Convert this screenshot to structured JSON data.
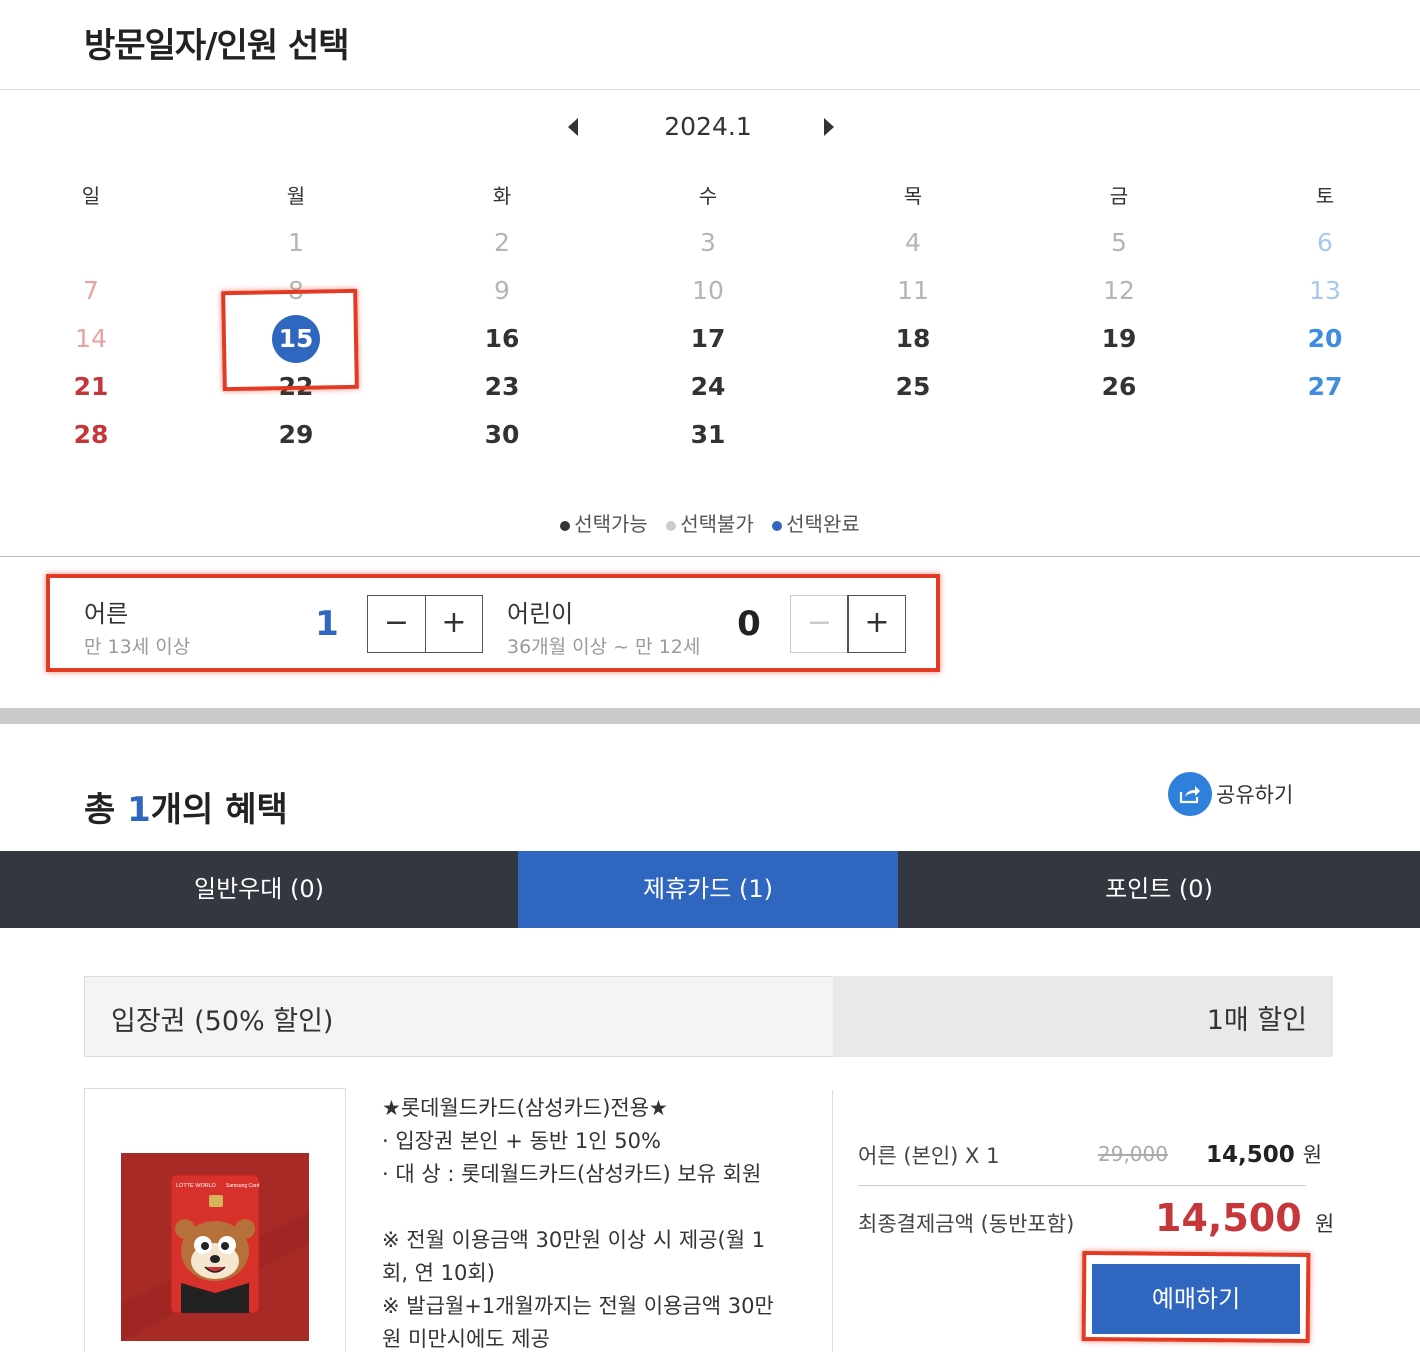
{
  "section_title": "방문일자/인원 선택",
  "calendar": {
    "month_label": "2024.1",
    "weekdays": [
      "일",
      "월",
      "화",
      "수",
      "목",
      "금",
      "토"
    ],
    "days": {
      "d1": "1",
      "d2": "2",
      "d3": "3",
      "d4": "4",
      "d5": "5",
      "d6": "6",
      "d7": "7",
      "d8": "8",
      "d9": "9",
      "d10": "10",
      "d11": "11",
      "d12": "12",
      "d13": "13",
      "d14": "14",
      "d15": "15",
      "d16": "16",
      "d17": "17",
      "d18": "18",
      "d19": "19",
      "d20": "20",
      "d21": "21",
      "d22": "22",
      "d23": "23",
      "d24": "24",
      "d25": "25",
      "d26": "26",
      "d27": "27",
      "d28": "28",
      "d29": "29",
      "d30": "30",
      "d31": "31"
    },
    "legend": {
      "available": "선택가능",
      "unavailable": "선택불가",
      "selected": "선택완료"
    }
  },
  "persons": {
    "adult": {
      "label": "어른",
      "sub": "만 13세 이상",
      "count": "1"
    },
    "child": {
      "label": "어린이",
      "sub": "36개월 이상 ~ 만 12세",
      "count": "0"
    },
    "minus": "−",
    "plus": "+"
  },
  "benefits": {
    "title_prefix": "총 ",
    "title_count": "1",
    "title_suffix": "개의 혜택",
    "share_label": "공유하기",
    "tabs": [
      "일반우대 (0)",
      "제휴카드 (1)",
      "포인트 (0)"
    ]
  },
  "coupon": {
    "name": "입장권 (50% 할인)",
    "limit": "1매 할인",
    "desc_lines": [
      "★롯데월드카드(삼성카드)전용★",
      "· 입장권 본인 + 동반 1인 50%",
      "· 대 상 : 롯데월드카드(삼성카드) 보유 회원",
      "",
      "※ 전월 이용금액 30만원 이상 시 제공(월 1",
      "회, 연 10회)",
      "※ 발급월+1개월까지는 전월 이용금액 30만",
      "원 미만시에도 제공"
    ],
    "card_brand": "LOTTE WORLD",
    "card_issuer": "Samsung Card",
    "price_label": "어른 (본인) X 1",
    "old_price": "29,000",
    "new_price": "14,500",
    "won": "원",
    "total_label": "최종결제금액 (동반포함)",
    "total_price": "14,500",
    "buy_label": "예매하기"
  },
  "colors": {
    "accent_blue": "#2f66c0",
    "sunday_red": "#c5373b",
    "saturday_blue": "#3e8de0",
    "annotation_red": "#e23a24",
    "tab_dark": "#343640"
  }
}
